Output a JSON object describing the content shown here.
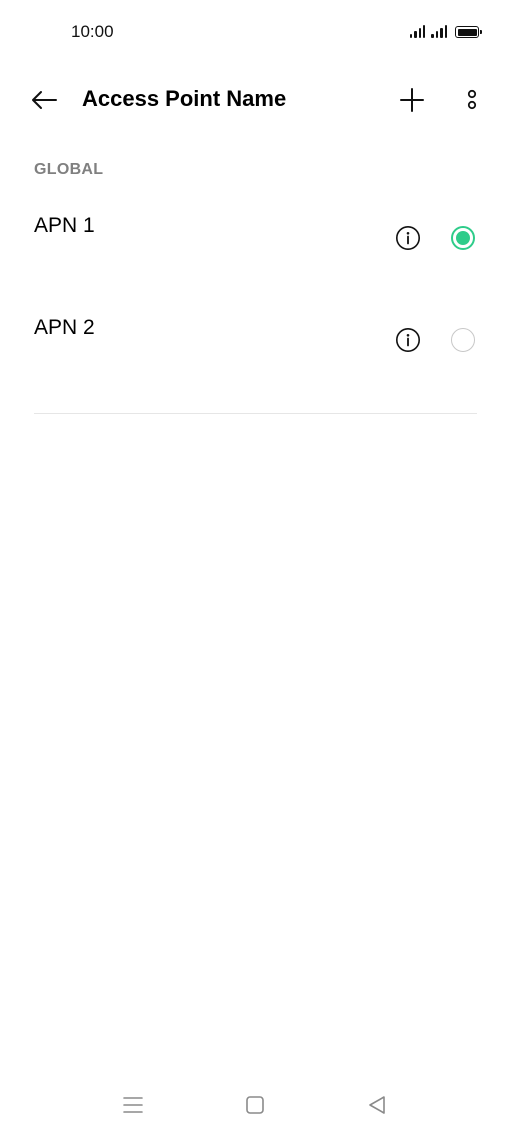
{
  "status_bar": {
    "time": "10:00",
    "signal_icons": [
      "signal-icon",
      "signal-icon"
    ],
    "battery_icon": "battery-icon"
  },
  "app_bar": {
    "title": "Access Point Name",
    "back_icon": "back-arrow-icon",
    "add_icon": "plus-icon",
    "more_icon": "more-options-icon"
  },
  "section": {
    "header": "GLOBAL"
  },
  "apns": [
    {
      "label": "APN 1",
      "selected": true
    },
    {
      "label": "APN 2",
      "selected": false
    }
  ],
  "nav_bar": {
    "menu_icon": "menu-icon",
    "home_icon": "home-icon",
    "back_icon": "back-triangle-icon"
  },
  "colors": {
    "accent": "#2ecc8a",
    "section_header": "#808080",
    "divider": "#e6e6e6",
    "radio_unchecked": "#c8c8c8",
    "nav_icons": "#8a8a8a"
  }
}
